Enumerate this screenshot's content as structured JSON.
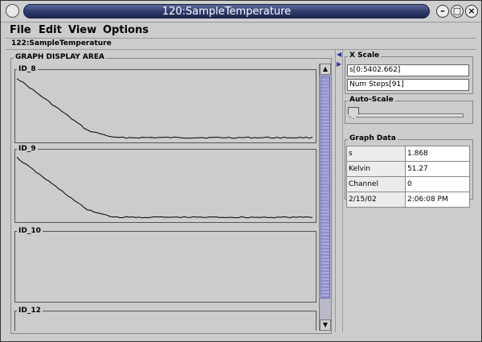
{
  "window": {
    "title": "120:SampleTemperature"
  },
  "menu": [
    "File",
    "Edit",
    "View",
    "Options"
  ],
  "inner_frame_title": "122:SampleTemperature",
  "graph_area": {
    "title": "GRAPH DISPLAY AREA",
    "graphs": [
      {
        "label": "ID_8",
        "has_trace": true
      },
      {
        "label": "ID_9",
        "has_trace": true
      },
      {
        "label": "ID_10",
        "has_trace": false
      },
      {
        "label": "ID_12",
        "has_trace": false
      }
    ]
  },
  "x_scale": {
    "title": "X Scale",
    "range_field": "s[0:5402.662]",
    "steps_field": "Num Steps[91]"
  },
  "auto_scale": {
    "title": "Auto-Scale",
    "value": 0
  },
  "graph_data": {
    "title": "Graph Data",
    "rows": [
      [
        "s",
        "1.868"
      ],
      [
        "Kelvin",
        "51.27"
      ],
      [
        "Channel",
        "0"
      ],
      [
        "2/15/02",
        "2:06:08 PM"
      ]
    ]
  },
  "colors": {
    "title_bar": "#2f3a6c",
    "scroll_thumb": "#a9a9dd",
    "window_bg": "#cccccc"
  }
}
